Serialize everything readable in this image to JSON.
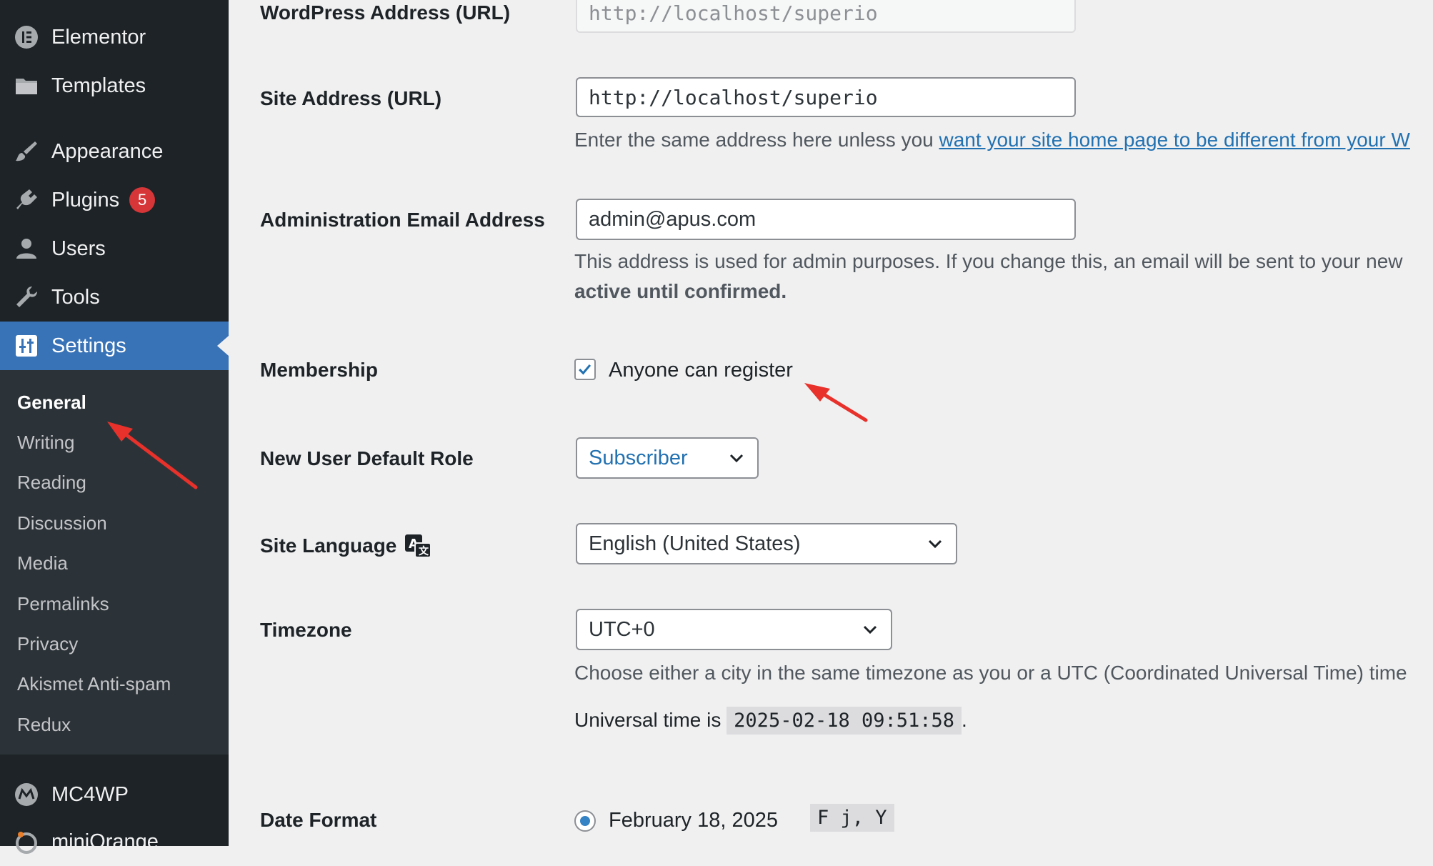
{
  "sidebar": {
    "items": [
      {
        "label": "Elementor",
        "icon": "elementor-icon"
      },
      {
        "label": "Templates",
        "icon": "folder-icon"
      },
      {
        "label": "Appearance",
        "icon": "paintbrush-icon"
      },
      {
        "label": "Plugins",
        "icon": "plug-icon",
        "badge": "5"
      },
      {
        "label": "Users",
        "icon": "user-icon"
      },
      {
        "label": "Tools",
        "icon": "wrench-icon"
      },
      {
        "label": "Settings",
        "icon": "settings-icon"
      },
      {
        "label": "MC4WP",
        "icon": "mc4wp-icon"
      },
      {
        "label": "miniOrange",
        "icon": "miniorange-icon"
      }
    ],
    "submenu": [
      "General",
      "Writing",
      "Reading",
      "Discussion",
      "Media",
      "Permalinks",
      "Privacy",
      "Akismet Anti-spam",
      "Redux"
    ]
  },
  "form": {
    "wp_address": {
      "label": "WordPress Address (URL)",
      "value": "http://localhost/superio"
    },
    "site_address": {
      "label": "Site Address (URL)",
      "value": "http://localhost/superio",
      "desc_prefix": "Enter the same address here unless you ",
      "desc_link": "want your site home page to be different from your W"
    },
    "admin_email": {
      "label": "Administration Email Address",
      "value": "admin@apus.com",
      "desc_line1": "This address is used for admin purposes. If you change this, an email will be sent to your new",
      "desc_line2": "active until confirmed."
    },
    "membership": {
      "label": "Membership",
      "checkbox_label": "Anyone can register",
      "checked": true
    },
    "default_role": {
      "label": "New User Default Role",
      "value": "Subscriber"
    },
    "site_language": {
      "label": "Site Language",
      "value": "English (United States)"
    },
    "timezone": {
      "label": "Timezone",
      "value": "UTC+0",
      "desc": "Choose either a city in the same timezone as you or a UTC (Coordinated Universal Time) time",
      "universal_prefix": "Universal time is ",
      "universal_time": "2025-02-18 09:51:58",
      "universal_suffix": "."
    },
    "date_format": {
      "label": "Date Format",
      "option_label": "February 18, 2025",
      "code": "F j, Y"
    }
  },
  "colors": {
    "accent": "#3872b7",
    "sidebar": "#1d2327",
    "submenu": "#2c3338",
    "badge": "#d63638",
    "arrow": "#e8312a",
    "link": "#2271b1"
  }
}
